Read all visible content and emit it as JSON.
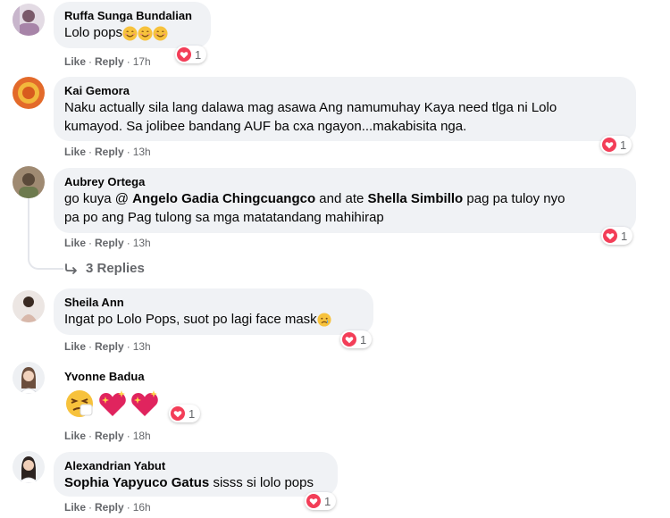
{
  "actions": {
    "like": "Like",
    "reply": "Reply"
  },
  "comments": [
    {
      "author": "Ruffa Sunga Bundalian",
      "text": "Lolo pops",
      "time": "17h",
      "reactions": "1"
    },
    {
      "author": "Kai Gemora",
      "text_line1": "Naku actually sila lang dalawa mag asawa Ang namumuhay Kaya need tlga ni Lolo",
      "text_line2": "kumayod. Sa jolibee bandang AUF ba cxa ngayon...makabisita nga.",
      "time": "13h",
      "reactions": "1"
    },
    {
      "author": "Aubrey Ortega",
      "prefix": "go kuya @ ",
      "mention1": "Angelo Gadia Chingcuangco",
      "middle": " and ate ",
      "mention2": "Shella Simbillo",
      "suffix": " pag pa tuloy nyo",
      "text_line2": "pa po ang Pag tulong sa mga matatandang mahihirap",
      "time": "13h",
      "reactions": "1",
      "replies": "3 Replies"
    },
    {
      "author": "Sheila Ann",
      "text": "Ingat po Lolo Pops, suot po lagi face mask",
      "time": "13h",
      "reactions": "1"
    },
    {
      "author": "Yvonne Badua",
      "time": "18h",
      "reactions": "1"
    },
    {
      "author": "Alexandrian Yabut",
      "mention": "Sophia Yapyuco Gatus",
      "text": " sisss si lolo pops",
      "time": "16h",
      "reactions": "1"
    }
  ],
  "colors": {
    "bubble": "#f0f2f5",
    "meta": "#65676b",
    "heart": "#f33e58"
  }
}
